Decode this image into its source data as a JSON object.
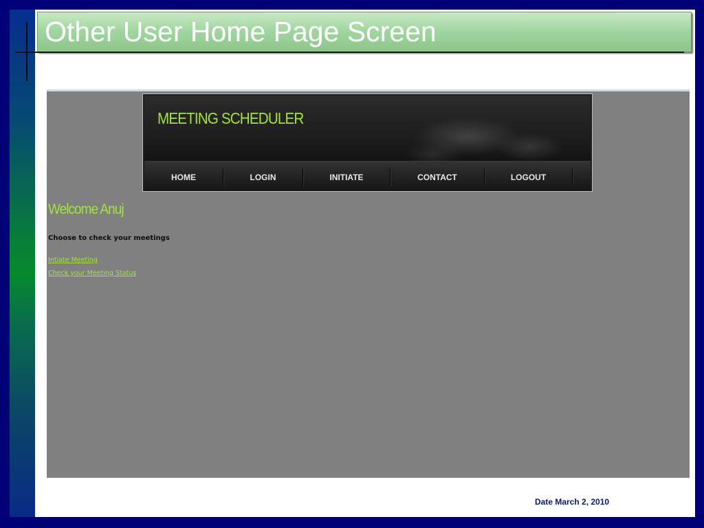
{
  "slide": {
    "title": "Other User Home Page Screen",
    "footer_date": "Date  March 2, 2010"
  },
  "app": {
    "logo": "MEETING SCHEDULER",
    "nav": [
      {
        "label": "HOME"
      },
      {
        "label": "LOGIN"
      },
      {
        "label": "INITIATE"
      },
      {
        "label": "CONTACT"
      },
      {
        "label": "LOGOUT"
      }
    ],
    "welcome": "Welcome Anuj",
    "prompt": "Choose to check your meetings",
    "links": [
      {
        "label": "Intiate Meeting"
      },
      {
        "label": "Check your Meeting Status"
      }
    ]
  },
  "colors": {
    "page_background": "#000077",
    "title_bar": "#a3d7a1",
    "app_background": "#808080",
    "app_accent": "#a4e33b",
    "header_dark": "#1d1d1d",
    "footer_text": "#0a1a6e"
  }
}
